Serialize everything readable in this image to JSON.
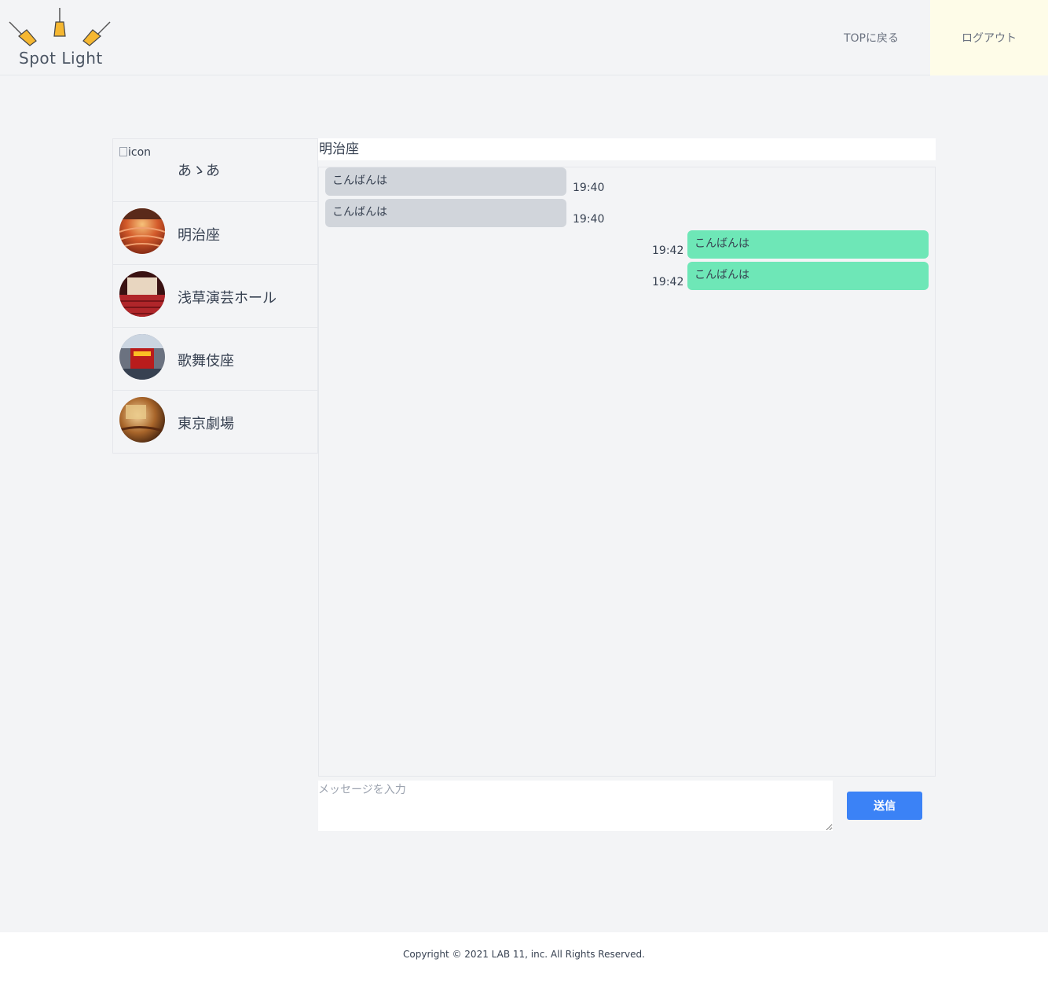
{
  "header": {
    "logo_text": "Spot Light",
    "nav_top_label": "TOPに戻る",
    "nav_logout_label": "ログアウト"
  },
  "sidebar": {
    "rooms": [
      {
        "name": "あゝあ",
        "icon_alt": "icon",
        "icon": "broken-image"
      },
      {
        "name": "明治座",
        "icon": "theater-photo-red-seats"
      },
      {
        "name": "浅草演芸ホール",
        "icon": "theater-photo-hall"
      },
      {
        "name": "歌舞伎座",
        "icon": "theater-photo-kabuki"
      },
      {
        "name": "東京劇場",
        "icon": "theater-photo-tokyo"
      }
    ]
  },
  "chat": {
    "title": "明治座",
    "messages": [
      {
        "direction": "received",
        "text": "こんばんは",
        "time": "19:40"
      },
      {
        "direction": "received",
        "text": "こんばんは",
        "time": "19:40"
      },
      {
        "direction": "sent",
        "text": "こんばんは",
        "time": "19:42"
      },
      {
        "direction": "sent",
        "text": "こんばんは",
        "time": "19:42"
      }
    ]
  },
  "composer": {
    "placeholder": "メッセージを入力",
    "value": "",
    "send_label": "送信"
  },
  "footer": {
    "copyright": "Copyright © 2021 LAB 11, inc. All Rights Reserved."
  },
  "colors": {
    "page_bg": "#f3f4f6",
    "received_bubble": "#d1d5db",
    "sent_bubble": "#6ee7b7",
    "send_button": "#3b82f6",
    "logout_bg": "#fefce8",
    "lamp": "#f5b731"
  }
}
